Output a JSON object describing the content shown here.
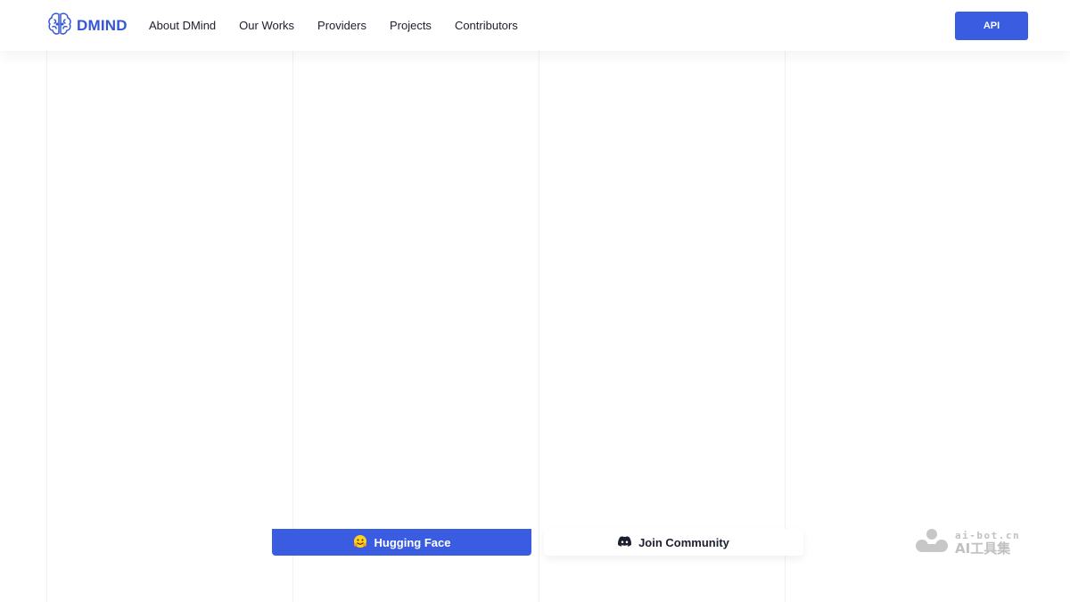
{
  "header": {
    "logo": {
      "text": "DMIND",
      "icon": "brain-icon"
    },
    "nav": [
      {
        "label": "About DMind"
      },
      {
        "label": "Our Works"
      },
      {
        "label": "Providers"
      },
      {
        "label": "Projects"
      },
      {
        "label": "Contributors"
      }
    ],
    "api_button": "API"
  },
  "actions": {
    "hugging_face": {
      "label": "Hugging Face",
      "icon": "hugging-face-emoji-icon"
    },
    "join_community": {
      "label": "Join Community",
      "icon": "discord-icon"
    }
  },
  "watermark": {
    "top": "ai-bot.cn",
    "bottom": "AI工具集",
    "icon": "ai-bot-logo-icon"
  },
  "colors": {
    "brand": "#3556d8",
    "button": "#3a5ce0"
  }
}
